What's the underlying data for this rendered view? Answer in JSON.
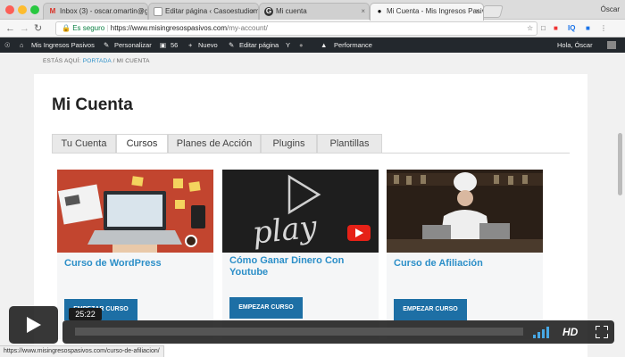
{
  "browser": {
    "tabs": [
      {
        "title": "Inbox (3) - oscar.omartin@gm",
        "icon": "gmail-icon",
        "active": false
      },
      {
        "title": "Editar página ‹ Casoestudiom",
        "icon": "page-icon",
        "active": false
      },
      {
        "title": "Mi cuenta",
        "icon": "wordpress-icon",
        "active": false
      },
      {
        "title": "Mi Cuenta - Mis Ingresos Pasiv",
        "icon": "page-icon",
        "active": true
      }
    ],
    "profile": "Óscar",
    "secure_label": "Es seguro",
    "url_host": "https://www.misingresospasivos.com",
    "url_path": "/my-account/"
  },
  "adminbar": {
    "site_name": "Mis Ingresos Pasivos",
    "customize": "Personalizar",
    "comments_count": "56",
    "new": "Nuevo",
    "edit_page": "Editar página",
    "performance": "Performance",
    "greeting": "Hola, Óscar"
  },
  "breadcrumb": {
    "prefix": "ESTÁS AQUÍ:",
    "home": "PORTADA",
    "separator": "/",
    "current": "MI CUENTA"
  },
  "page": {
    "title": "Mi Cuenta",
    "tabs": [
      "Tu Cuenta",
      "Cursos",
      "Planes de Acción",
      "Plugins",
      "Plantillas"
    ],
    "active_tab": "Cursos"
  },
  "courses": [
    {
      "title": "Curso de WordPress",
      "button": "EMPEZAR CURSO"
    },
    {
      "title": "Cómo Ganar Dinero Con Youtube",
      "button": "EMPEZAR CURSO"
    },
    {
      "title": "Curso de Afiliación",
      "button": "EMPEZAR CURSO"
    }
  ],
  "video": {
    "time": "25:22",
    "progress": 0.0,
    "hd_label": "HD"
  },
  "status_url": "https://www.misingresospasivos.com/curso-de-afiliacion/",
  "colors": {
    "accent": "#2c8fc8",
    "button": "#1d6fa5",
    "adminbar": "#23282d"
  }
}
